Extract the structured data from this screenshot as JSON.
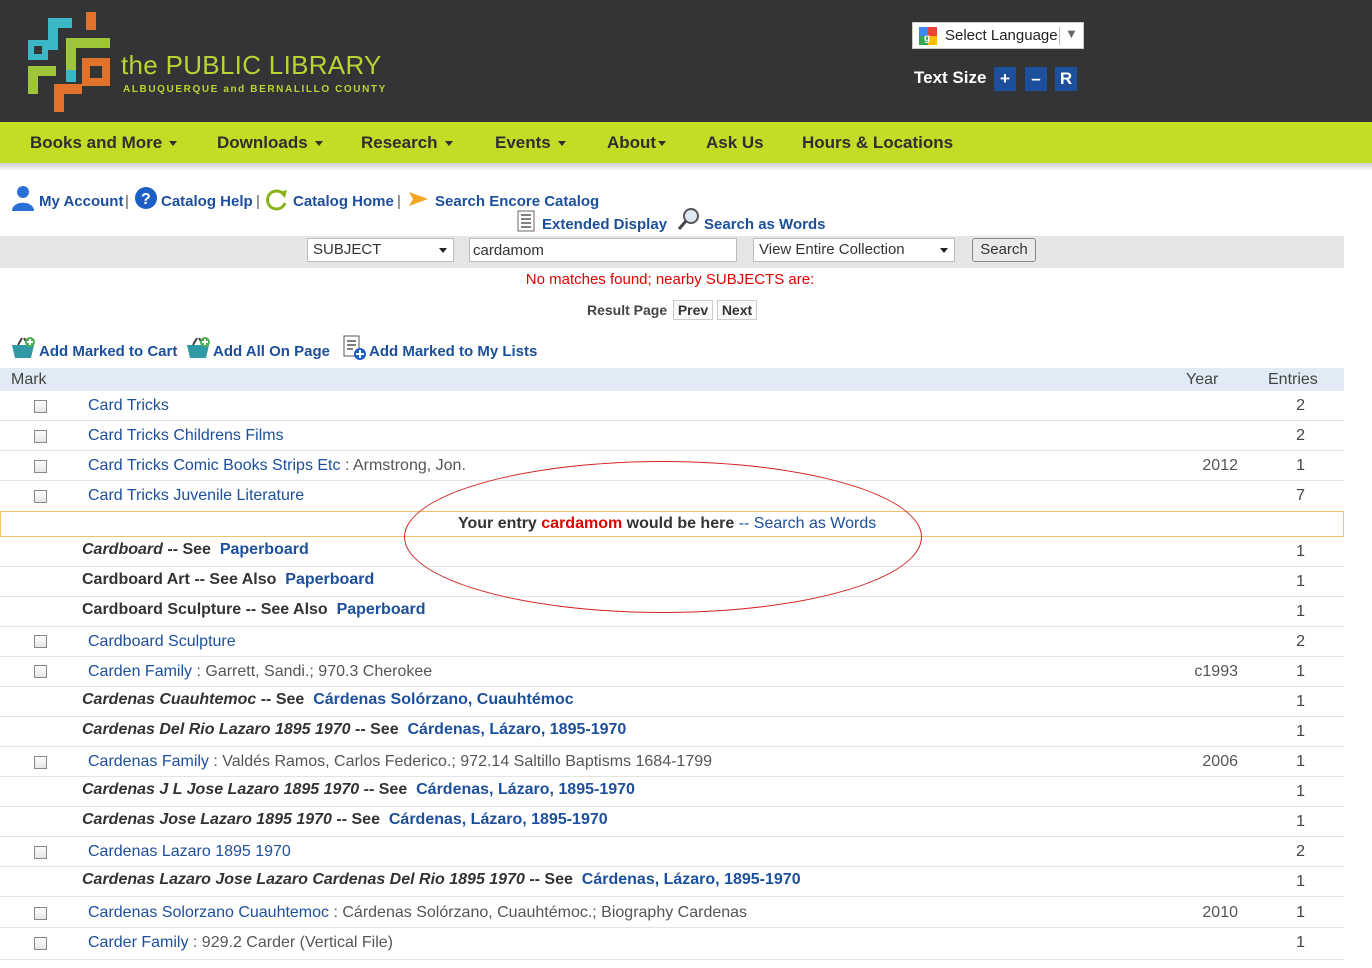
{
  "header": {
    "logo_title": "the PUBLIC LIBRARY",
    "logo_subtitle": "ALBUQUERQUE and BERNALILLO COUNTY",
    "language_select": "Select Language",
    "text_size_label": "Text Size",
    "text_size_buttons": [
      "+",
      "–",
      "R"
    ]
  },
  "nav": {
    "items": [
      "Books and More",
      "Downloads",
      "Research",
      "Events",
      "About",
      "Ask Us",
      "Hours & Locations"
    ]
  },
  "toolbar": {
    "my_account": "My Account",
    "catalog_help": "Catalog Help",
    "catalog_home": "Catalog Home",
    "search_encore": "Search Encore Catalog",
    "extended_display": "Extended Display",
    "search_as_words": "Search as Words",
    "separator": "|"
  },
  "search": {
    "type": "SUBJECT",
    "query": "cardamom",
    "scope": "View Entire Collection",
    "button": "Search"
  },
  "results": {
    "message": "No matches found; nearby SUBJECTS are:",
    "result_page_label": "Result Page",
    "prev": "Prev",
    "next": "Next"
  },
  "actions": {
    "add_marked_cart": "Add Marked to Cart",
    "add_all_page": "Add All On Page",
    "add_marked_lists": "Add Marked to My Lists"
  },
  "table": {
    "headers": {
      "mark": "Mark",
      "year": "Year",
      "entries": "Entries"
    },
    "entry_note": {
      "prefix": "Your entry",
      "term": "cardamom",
      "suffix": "would be here",
      "dash": "--",
      "link": "Search as Words"
    },
    "rows": [
      {
        "subject": "Card Tricks",
        "detail": "",
        "year": "",
        "entries": "2"
      },
      {
        "subject": "Card Tricks Childrens Films",
        "detail": "",
        "year": "",
        "entries": "2"
      },
      {
        "subject": "Card Tricks Comic Books Strips Etc",
        "detail": " : Armstrong, Jon.",
        "year": "2012",
        "entries": "1"
      },
      {
        "subject": "Card Tricks Juvenile Literature",
        "detail": "",
        "year": "",
        "entries": "7"
      },
      {
        "see_term": "Cardboard",
        "see_type": "-- See",
        "see_link": "Paperboard",
        "italic": true,
        "entries": "1"
      },
      {
        "see_term": "Cardboard Art",
        "see_type": "-- See Also",
        "see_link": "Paperboard",
        "italic": false,
        "entries": "1"
      },
      {
        "see_term": "Cardboard Sculpture",
        "see_type": "-- See Also",
        "see_link": "Paperboard",
        "italic": false,
        "entries": "1"
      },
      {
        "subject": "Cardboard Sculpture",
        "detail": "",
        "year": "",
        "entries": "2"
      },
      {
        "subject": "Carden Family",
        "detail": " : Garrett, Sandi.; 970.3 Cherokee",
        "year": "c1993",
        "entries": "1"
      },
      {
        "see_term": "Cardenas Cuauhtemoc",
        "see_type": "-- See",
        "see_link": "Cárdenas Solórzano, Cuauhtémoc",
        "italic": true,
        "entries": "1"
      },
      {
        "see_term": "Cardenas Del Rio Lazaro 1895 1970",
        "see_type": "-- See",
        "see_link": "Cárdenas, Lázaro, 1895-1970",
        "italic": true,
        "entries": "1"
      },
      {
        "subject": "Cardenas Family",
        "detail": " : Valdés Ramos, Carlos Federico.; 972.14 Saltillo Baptisms 1684-1799",
        "year": "2006",
        "entries": "1"
      },
      {
        "see_term": "Cardenas J L Jose Lazaro 1895 1970",
        "see_type": "-- See",
        "see_link": "Cárdenas, Lázaro, 1895-1970",
        "italic": true,
        "entries": "1"
      },
      {
        "see_term": "Cardenas Jose Lazaro 1895 1970",
        "see_type": "-- See",
        "see_link": "Cárdenas, Lázaro, 1895-1970",
        "italic": true,
        "entries": "1"
      },
      {
        "subject": "Cardenas Lazaro 1895 1970",
        "detail": "",
        "year": "",
        "entries": "2"
      },
      {
        "see_term": "Cardenas Lazaro Jose Lazaro Cardenas Del Rio 1895 1970",
        "see_type": "-- See",
        "see_link": "Cárdenas, Lázaro, 1895-1970",
        "italic": true,
        "entries": "1"
      },
      {
        "subject": "Cardenas Solorzano Cuauhtemoc",
        "detail": " : Cárdenas Solórzano, Cuauhtémoc.; Biography Cardenas",
        "year": "2010",
        "entries": "1"
      },
      {
        "subject": "Carder Family",
        "detail": " : 929.2 Carder (Vertical File)",
        "year": "",
        "entries": "1"
      }
    ]
  },
  "colors": {
    "header_bg": "#333436",
    "nav_bg": "#c3dc26",
    "logo_green": "#b8d433",
    "link_blue": "#1c4f9c",
    "alert_red": "#e00000"
  }
}
